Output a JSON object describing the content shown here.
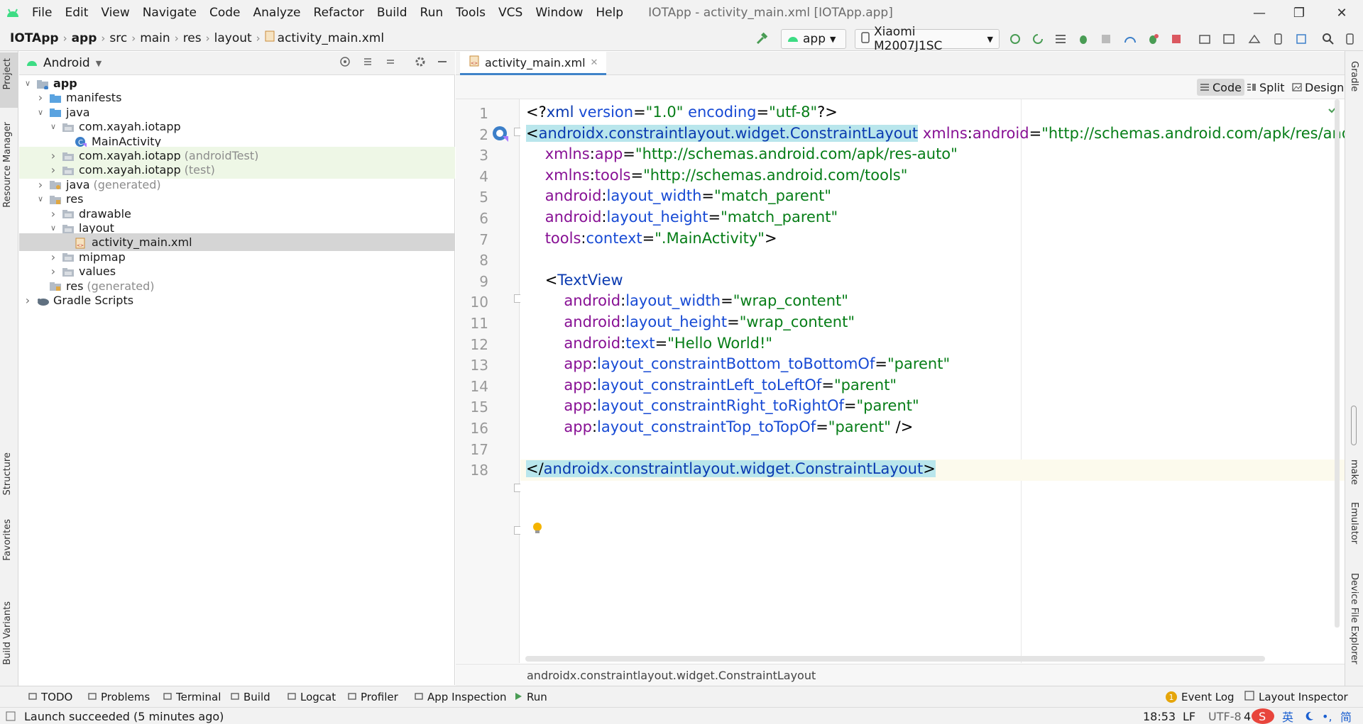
{
  "window": {
    "title": "IOTApp - activity_main.xml [IOTApp.app]",
    "menu": [
      "File",
      "Edit",
      "View",
      "Navigate",
      "Code",
      "Analyze",
      "Refactor",
      "Build",
      "Run",
      "Tools",
      "VCS",
      "Window",
      "Help"
    ]
  },
  "breadcrumb": [
    "IOTApp",
    "app",
    "src",
    "main",
    "res",
    "layout",
    "activity_main.xml"
  ],
  "toolbar": {
    "run_config": "app",
    "device": "Xiaomi M2007J1SC"
  },
  "project_panel": {
    "view_selector": "Android",
    "tree": [
      {
        "label": "app",
        "note": "",
        "depth": 0,
        "expanded": true,
        "icon": "module-folder-icon",
        "bold": true
      },
      {
        "label": "manifests",
        "note": "",
        "depth": 1,
        "expanded": false,
        "icon": "folder-icon"
      },
      {
        "label": "java",
        "note": "",
        "depth": 1,
        "expanded": true,
        "icon": "folder-icon"
      },
      {
        "label": "com.xayah.iotapp",
        "note": "",
        "depth": 2,
        "expanded": true,
        "icon": "package-icon"
      },
      {
        "label": "MainActivity",
        "note": "",
        "depth": 3,
        "expanded": null,
        "icon": "kotlin-class-icon"
      },
      {
        "label": "com.xayah.iotapp",
        "note": "(androidTest)",
        "depth": 2,
        "expanded": false,
        "icon": "package-icon",
        "test": true
      },
      {
        "label": "com.xayah.iotapp",
        "note": "(test)",
        "depth": 2,
        "expanded": false,
        "icon": "package-icon",
        "test": true
      },
      {
        "label": "java",
        "note": "(generated)",
        "depth": 1,
        "expanded": false,
        "icon": "generated-folder-icon"
      },
      {
        "label": "res",
        "note": "",
        "depth": 1,
        "expanded": true,
        "icon": "res-folder-icon"
      },
      {
        "label": "drawable",
        "note": "",
        "depth": 2,
        "expanded": false,
        "icon": "package-icon"
      },
      {
        "label": "layout",
        "note": "",
        "depth": 2,
        "expanded": true,
        "icon": "package-icon"
      },
      {
        "label": "activity_main.xml",
        "note": "",
        "depth": 3,
        "expanded": null,
        "icon": "xml-file-icon",
        "selected": true
      },
      {
        "label": "mipmap",
        "note": "",
        "depth": 2,
        "expanded": false,
        "icon": "package-icon"
      },
      {
        "label": "values",
        "note": "",
        "depth": 2,
        "expanded": false,
        "icon": "package-icon"
      },
      {
        "label": "res",
        "note": "(generated)",
        "depth": 1,
        "expanded": null,
        "icon": "res-folder-icon"
      },
      {
        "label": "Gradle Scripts",
        "note": "",
        "depth": 0,
        "expanded": false,
        "icon": "gradle-icon"
      }
    ]
  },
  "left_strip": [
    "Project",
    "Resource Manager",
    "Structure",
    "Favorites",
    "Build Variants"
  ],
  "right_strip": [
    "Gradle",
    "make",
    "Emulator",
    "Device File Explorer"
  ],
  "editor": {
    "tab": "activity_main.xml",
    "modes": [
      "Code",
      "Split",
      "Design"
    ],
    "active_mode": "Code",
    "lines": [
      [
        [
          "c-punc",
          "<?"
        ],
        [
          "c-tag",
          "xml"
        ],
        [
          "c-attr",
          " version"
        ],
        [
          "c-punc",
          "="
        ],
        [
          "c-val",
          "\"1.0\""
        ],
        [
          "c-attr",
          " encoding"
        ],
        [
          "c-punc",
          "="
        ],
        [
          "c-val",
          "\"utf-8\""
        ],
        [
          "c-punc",
          "?>"
        ]
      ],
      [
        [
          "c-punc hl",
          "<"
        ],
        [
          "c-tag hl",
          "androidx.constraintlayout.widget.ConstraintLayout"
        ],
        [
          "c-punc",
          " "
        ],
        [
          "c-ns",
          "xmlns"
        ],
        [
          "c-punc",
          ":"
        ],
        [
          "c-ns",
          "android"
        ],
        [
          "c-punc",
          "="
        ],
        [
          "c-val",
          "\"http://schemas.android.com/apk/res/android\""
        ]
      ],
      [
        [
          "c-punc",
          "    "
        ],
        [
          "c-ns",
          "xmlns"
        ],
        [
          "c-punc",
          ":"
        ],
        [
          "c-ns",
          "app"
        ],
        [
          "c-punc",
          "="
        ],
        [
          "c-val",
          "\"http://schemas.android.com/apk/res-auto\""
        ]
      ],
      [
        [
          "c-punc",
          "    "
        ],
        [
          "c-ns",
          "xmlns"
        ],
        [
          "c-punc",
          ":"
        ],
        [
          "c-ns",
          "tools"
        ],
        [
          "c-punc",
          "="
        ],
        [
          "c-val",
          "\"http://schemas.android.com/tools\""
        ]
      ],
      [
        [
          "c-punc",
          "    "
        ],
        [
          "c-ns",
          "android"
        ],
        [
          "c-punc",
          ":"
        ],
        [
          "c-attr",
          "layout_width"
        ],
        [
          "c-punc",
          "="
        ],
        [
          "c-val",
          "\"match_parent\""
        ]
      ],
      [
        [
          "c-punc",
          "    "
        ],
        [
          "c-ns",
          "android"
        ],
        [
          "c-punc",
          ":"
        ],
        [
          "c-attr",
          "layout_height"
        ],
        [
          "c-punc",
          "="
        ],
        [
          "c-val",
          "\"match_parent\""
        ]
      ],
      [
        [
          "c-punc",
          "    "
        ],
        [
          "c-ns",
          "tools"
        ],
        [
          "c-punc",
          ":"
        ],
        [
          "c-attr",
          "context"
        ],
        [
          "c-punc",
          "="
        ],
        [
          "c-val",
          "\".MainActivity\""
        ],
        [
          "c-punc",
          ">"
        ]
      ],
      [],
      [
        [
          "c-punc",
          "    <"
        ],
        [
          "c-tag",
          "TextView"
        ]
      ],
      [
        [
          "c-punc",
          "        "
        ],
        [
          "c-ns",
          "android"
        ],
        [
          "c-punc",
          ":"
        ],
        [
          "c-attr",
          "layout_width"
        ],
        [
          "c-punc",
          "="
        ],
        [
          "c-val",
          "\"wrap_content\""
        ]
      ],
      [
        [
          "c-punc",
          "        "
        ],
        [
          "c-ns",
          "android"
        ],
        [
          "c-punc",
          ":"
        ],
        [
          "c-attr",
          "layout_height"
        ],
        [
          "c-punc",
          "="
        ],
        [
          "c-val",
          "\"wrap_content\""
        ]
      ],
      [
        [
          "c-punc",
          "        "
        ],
        [
          "c-ns",
          "android"
        ],
        [
          "c-punc",
          ":"
        ],
        [
          "c-attr",
          "text"
        ],
        [
          "c-punc",
          "="
        ],
        [
          "c-val",
          "\"Hello World!\""
        ]
      ],
      [
        [
          "c-punc",
          "        "
        ],
        [
          "c-ns",
          "app"
        ],
        [
          "c-punc",
          ":"
        ],
        [
          "c-attr",
          "layout_constraintBottom_toBottomOf"
        ],
        [
          "c-punc",
          "="
        ],
        [
          "c-val",
          "\"parent\""
        ]
      ],
      [
        [
          "c-punc",
          "        "
        ],
        [
          "c-ns",
          "app"
        ],
        [
          "c-punc",
          ":"
        ],
        [
          "c-attr",
          "layout_constraintLeft_toLeftOf"
        ],
        [
          "c-punc",
          "="
        ],
        [
          "c-val",
          "\"parent\""
        ]
      ],
      [
        [
          "c-punc",
          "        "
        ],
        [
          "c-ns",
          "app"
        ],
        [
          "c-punc",
          ":"
        ],
        [
          "c-attr",
          "layout_constraintRight_toRightOf"
        ],
        [
          "c-punc",
          "="
        ],
        [
          "c-val",
          "\"parent\""
        ]
      ],
      [
        [
          "c-punc",
          "        "
        ],
        [
          "c-ns",
          "app"
        ],
        [
          "c-punc",
          ":"
        ],
        [
          "c-attr",
          "layout_constraintTop_toTopOf"
        ],
        [
          "c-punc",
          "="
        ],
        [
          "c-val",
          "\"parent\""
        ],
        [
          "c-punc",
          " />"
        ]
      ],
      [],
      [
        [
          "c-punc hl",
          "</"
        ],
        [
          "c-tag hl",
          "androidx.constraintlayout.widget.ConstraintLayout"
        ],
        [
          "c-punc hl",
          ">"
        ]
      ]
    ],
    "breadcrumb": "androidx.constraintlayout.widget.ConstraintLayout"
  },
  "bottom_tools": [
    "TODO",
    "Problems",
    "Terminal",
    "Build",
    "Logcat",
    "Profiler",
    "App Inspection",
    "Run"
  ],
  "bottom_tools_right": [
    "Event Log",
    "Layout Inspector"
  ],
  "event_log_count": "1",
  "status": {
    "message": "Launch succeeded (5 minutes ago)",
    "position": "18:53",
    "line_sep": "LF",
    "encoding": "UTF-8",
    "indent": "4",
    "ime": "英"
  },
  "colors": {
    "accent": "#4083c9",
    "android_green": "#3ddc84",
    "run_green": "#499c54",
    "stop_red": "#db5860"
  }
}
